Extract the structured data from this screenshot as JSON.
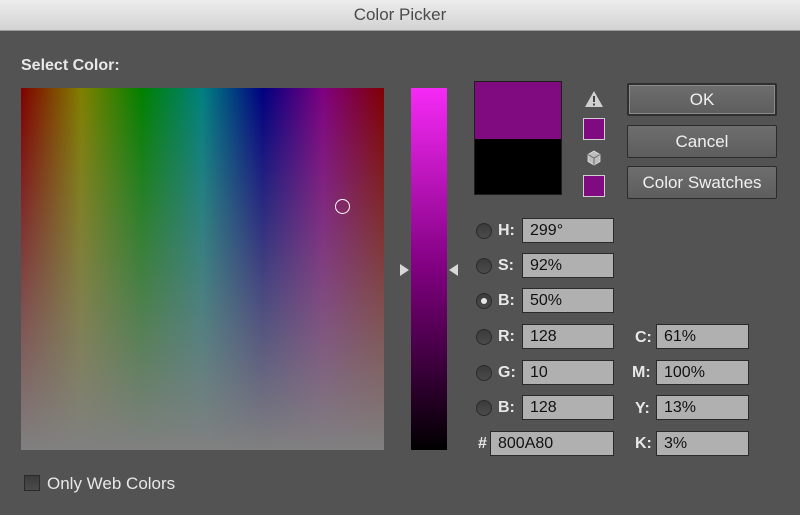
{
  "window": {
    "title": "Color Picker"
  },
  "select_color_label": "Select Color:",
  "buttons": {
    "ok": "OK",
    "cancel": "Cancel",
    "swatches": "Color Swatches"
  },
  "colors": {
    "new": "#800A80",
    "current": "#000000"
  },
  "icons": {
    "warning": "warning-triangle-icon",
    "websafe": "cube-icon"
  },
  "hsb": {
    "h": {
      "label": "H:",
      "value": "299°"
    },
    "s": {
      "label": "S:",
      "value": "92%"
    },
    "b": {
      "label": "B:",
      "value": "50%"
    }
  },
  "rgb": {
    "r": {
      "label": "R:",
      "value": "128"
    },
    "g": {
      "label": "G:",
      "value": "10"
    },
    "b": {
      "label": "B:",
      "value": "128"
    }
  },
  "hex": {
    "label": "#",
    "value": "800A80"
  },
  "cmyk": {
    "c": {
      "label": "C:",
      "value": "61%"
    },
    "m": {
      "label": "M:",
      "value": "100%"
    },
    "y": {
      "label": "Y:",
      "value": "13%"
    },
    "k": {
      "label": "K:",
      "value": "3%"
    }
  },
  "only_web_colors": {
    "label": "Only Web Colors",
    "checked": false
  },
  "selected_mode": "B"
}
